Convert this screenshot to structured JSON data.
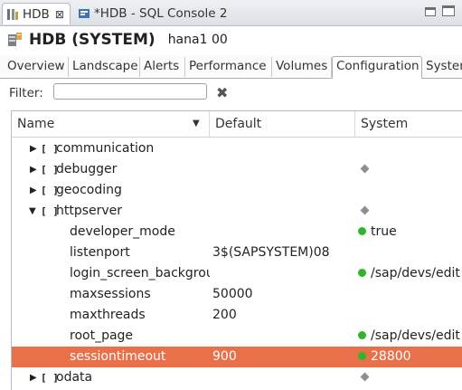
{
  "editor_tabs": [
    {
      "label": "HDB",
      "close": "⊠"
    },
    {
      "label": "*HDB - SQL Console 2"
    }
  ],
  "header": {
    "title": "HDB (SYSTEM)",
    "subtitle": "hana1 00"
  },
  "subtabs": [
    "Overview",
    "Landscape",
    "Alerts",
    "Performance",
    "Volumes",
    "Configuration",
    "Syster"
  ],
  "filter": {
    "label": "Filter:",
    "value": "",
    "placeholder": ""
  },
  "table": {
    "columns": [
      "Name",
      "Default",
      "System"
    ],
    "rows": [
      {
        "name": "communication",
        "default": "",
        "system": ""
      },
      {
        "name": "debugger",
        "default": "",
        "system": "◆"
      },
      {
        "name": "geocoding",
        "default": "",
        "system": ""
      },
      {
        "name": "httpserver",
        "default": "",
        "system": "◆"
      },
      {
        "name": "developer_mode",
        "default": "",
        "system": "true"
      },
      {
        "name": "listenport",
        "default": "3$(SAPSYSTEM)08",
        "system": ""
      },
      {
        "name": "login_screen_backgrou",
        "default": "",
        "system": "/sap/devs/edit"
      },
      {
        "name": "maxsessions",
        "default": "50000",
        "system": ""
      },
      {
        "name": "maxthreads",
        "default": "200",
        "system": ""
      },
      {
        "name": "root_page",
        "default": "",
        "system": "/sap/devs/edit"
      },
      {
        "name": "sessiontimeout",
        "default": "900",
        "system": "28800"
      },
      {
        "name": "odata",
        "default": "",
        "system": "◆"
      }
    ]
  },
  "colors": {
    "selection": "#e8714a",
    "status_green": "#2fb52a"
  }
}
